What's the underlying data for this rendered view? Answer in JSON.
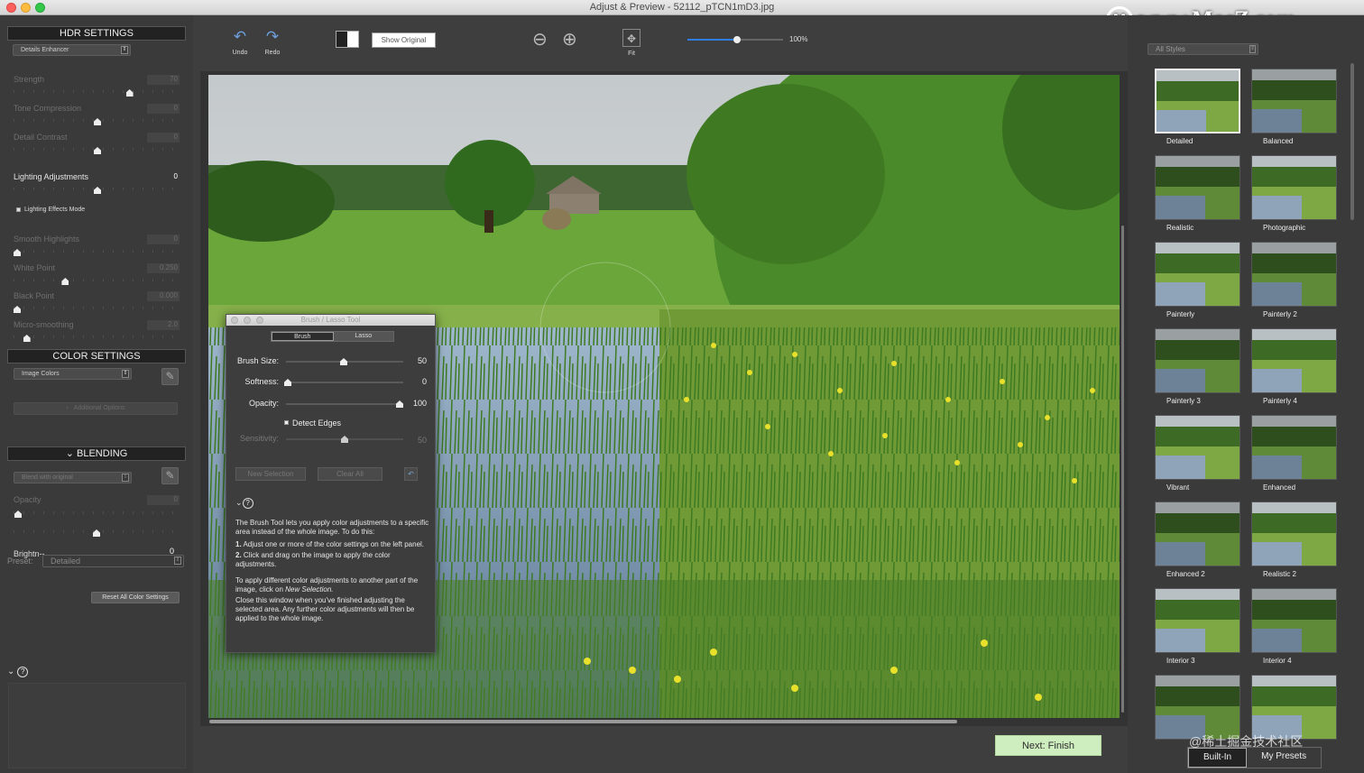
{
  "window": {
    "title": "Adjust & Preview - 52112_pTCN1mD3.jpg"
  },
  "watermark": {
    "text": "www.MacZ.com",
    "logo": "M"
  },
  "hdr": {
    "heading": "HDR SETTINGS",
    "preset_select": "Details Enhancer",
    "sliders": [
      {
        "label": "Strength",
        "value": "70",
        "fraction": 0.7,
        "enabled": false
      },
      {
        "label": "Tone Compression",
        "value": "0",
        "fraction": 0.5,
        "enabled": false
      },
      {
        "label": "Detail Contrast",
        "value": "0",
        "fraction": 0.5,
        "enabled": false
      },
      {
        "label": "Lighting Adjustments",
        "value": "0",
        "fraction": 0.5,
        "enabled": true
      },
      {
        "label": "Smooth Highlights",
        "value": "0",
        "fraction": 0.0,
        "enabled": false
      },
      {
        "label": "White Point",
        "value": "0.250",
        "fraction": 0.3,
        "enabled": false
      },
      {
        "label": "Black Point",
        "value": "0.000",
        "fraction": 0.0,
        "enabled": false
      },
      {
        "label": "Micro-smoothing",
        "value": "2.0",
        "fraction": 0.06,
        "enabled": false
      }
    ],
    "lighting_effects_mode": "Lighting Effects Mode"
  },
  "color": {
    "heading": "COLOR SETTINGS",
    "select": "Image Colors",
    "additional_options": "Additional Options"
  },
  "blending": {
    "heading": "BLENDING",
    "select": "Blend with original",
    "opacity_label": "Opacity",
    "opacity_value": "0",
    "brightness_label": "Brightn--",
    "brightness_value": "0",
    "preset_label": "Preset:",
    "preset_value": "Detailed",
    "reset_button": "Reset All Color Settings"
  },
  "toolbar": {
    "undo": "Undo",
    "redo": "Redo",
    "show_original": "Show Original",
    "fit": "Fit",
    "zoom_percent": "100%",
    "zoom_fraction": 0.52
  },
  "brush": {
    "title": "Brush / Lasso Tool",
    "tab_brush": "Brush",
    "tab_lasso": "Lasso",
    "brush_size_label": "Brush Size:",
    "brush_size_value": "50",
    "softness_label": "Softness:",
    "softness_value": "0",
    "opacity_label": "Opacity:",
    "opacity_value": "100",
    "detect_edges": "Detect Edges",
    "sensitivity_label": "Sensitivity:",
    "sensitivity_value": "50",
    "new_selection": "New Selection",
    "clear_all": "Clear All",
    "help_intro": "The Brush Tool lets you apply color adjustments to a specific area instead of the whole image. To do this:",
    "help_step1_num": "1.",
    "help_step1": "Adjust one or more of the color settings on the left panel.",
    "help_step2_num": "2.",
    "help_step2": "Click and drag on the image to apply the color adjustments.",
    "help_p2": "To apply different color adjustments to another part of the image, click on",
    "help_p2_em": "New Selection.",
    "help_p3": "Close this window when you've finished adjusting the selected area. Any further color adjustments will then be applied to the whole image."
  },
  "styles": {
    "filter": "All Styles",
    "items": [
      "Detailed",
      "Balanced",
      "Realistic",
      "Photographic",
      "Painterly",
      "Painterly 2",
      "Painterly 3",
      "Painterly 4",
      "Vibrant",
      "Enhanced",
      "Enhanced 2",
      "Realistic 2",
      "Interior 3",
      "Interior 4",
      "",
      ""
    ],
    "tab_builtin": "Built-In",
    "tab_mypresets": "My Presets"
  },
  "next_button": "Next: Finish",
  "bottom_watermark": "@稀土掘金技术社区",
  "colors": {
    "accent": "#2e7de0",
    "next_bg": "#cfeec0"
  }
}
